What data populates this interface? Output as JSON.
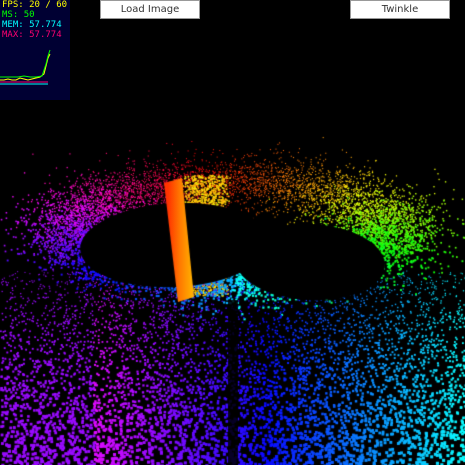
{
  "stats": {
    "fps_label": "FPS:",
    "fps_value": "20 / 60",
    "ms_label": "MS:",
    "ms_value": "50",
    "mem_label": "MEM:",
    "mem_value": "57.774",
    "max_label": "MAX:",
    "max_value": "57.774",
    "colors": {
      "fps": "#ffff00",
      "ms": "#00ff00",
      "mem": "#00ffff",
      "max": "#ff0070",
      "panel_bg": "#000033"
    }
  },
  "toolbar": {
    "load_label": "Load Image",
    "twinkle_label": "Twinkle"
  },
  "scene": {
    "background": "#000000",
    "description_icon": "particle-spiral"
  }
}
